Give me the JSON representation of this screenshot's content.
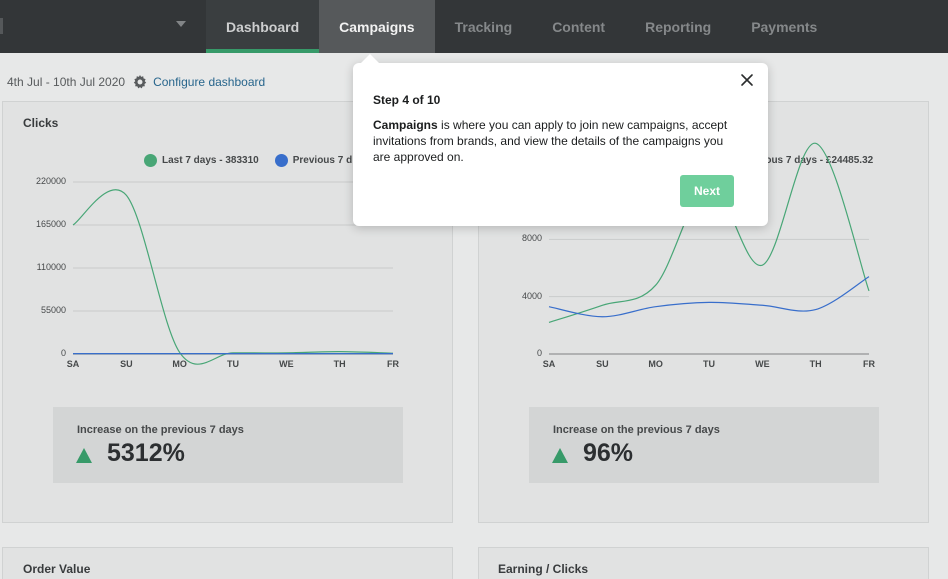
{
  "nav": {
    "items": [
      {
        "label": "Dashboard"
      },
      {
        "label": "Campaigns"
      },
      {
        "label": "Tracking"
      },
      {
        "label": "Content"
      },
      {
        "label": "Reporting"
      },
      {
        "label": "Payments"
      }
    ]
  },
  "toolbar": {
    "date_range": "4th Jul - 10th Jul 2020",
    "configure_label": "Configure dashboard"
  },
  "colors": {
    "accent_green": "#3aa36f",
    "series_current": "#4caf7d",
    "series_previous": "#3b74d6",
    "next_button": "#6fcf9c"
  },
  "clicks_card": {
    "title": "Clicks",
    "legend_current": "Last 7 days - 383310",
    "legend_previous": "Previous 7 d",
    "increase_label": "Increase on the previous 7 days",
    "increase_value": "5312%"
  },
  "earnings_card": {
    "legend_previous": "vious 7 days - £24485.32",
    "increase_label": "Increase on the previous 7 days",
    "increase_value": "96%"
  },
  "bottom_cards": {
    "left_title": "Order Value",
    "right_title": "Earning / Clicks"
  },
  "popover": {
    "step": "Step 4 of 10",
    "body_bold": "Campaigns",
    "body_text": " is where you can apply to join new campaigns, accept invitations from brands, and view the details of the campaigns you are approved on.",
    "next_label": "Next",
    "close_icon": "close-icon"
  },
  "chart_data": [
    {
      "type": "line",
      "title": "Clicks",
      "categories": [
        "SA",
        "SU",
        "MO",
        "TU",
        "WE",
        "TH",
        "FR"
      ],
      "yticks": [
        "220000",
        "165000",
        "110000",
        "55000",
        "0"
      ],
      "ylim": [
        0,
        220000
      ],
      "grid": true,
      "series": [
        {
          "name": "Last 7 days - 383310",
          "values": [
            165000,
            203000,
            2000,
            1500,
            1500,
            3000,
            1000
          ]
        },
        {
          "name": "Previous 7 d",
          "values": [
            500,
            500,
            500,
            500,
            500,
            500,
            500
          ]
        }
      ]
    },
    {
      "type": "line",
      "title": "",
      "categories": [
        "SA",
        "SU",
        "MO",
        "TU",
        "WE",
        "TH",
        "FR"
      ],
      "yticks": [
        "8000",
        "4000",
        "0"
      ],
      "ylim": [
        0,
        12000
      ],
      "grid": true,
      "series": [
        {
          "name": "",
          "values": [
            2200,
            3400,
            4800,
            11800,
            6200,
            14700,
            4400
          ]
        },
        {
          "name": "vious 7 days - £24485.32",
          "values": [
            3300,
            2600,
            3300,
            3600,
            3400,
            3100,
            5400
          ]
        }
      ]
    }
  ]
}
